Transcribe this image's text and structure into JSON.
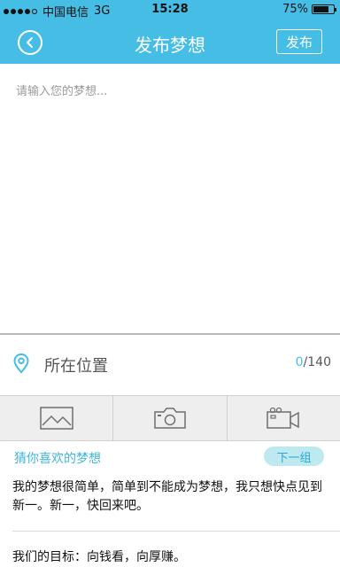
{
  "status_bar": {
    "carrier": "中国电信",
    "network": "3G",
    "time": "15:28",
    "battery_text": "75%",
    "battery_level": 0.75
  },
  "nav": {
    "title": "发布梦想",
    "publish_label": "发布"
  },
  "compose": {
    "placeholder": "请输入您的梦想...",
    "value": ""
  },
  "location": {
    "label": "所在位置",
    "count_current": "0",
    "count_max": "/140"
  },
  "media": {
    "icons": [
      "image-icon",
      "camera-icon",
      "video-icon"
    ]
  },
  "suggestions": {
    "title": "猜你喜欢的梦想",
    "next_label": "下一组",
    "items": [
      "我的梦想很简单，简单到不能成为梦想，我只想快点见到新一。新一，快回来吧。",
      "我们的目标：向钱看，向厚赚。"
    ]
  },
  "colors": {
    "accent": "#46bde4",
    "next_button_bg": "#bfe9f1"
  }
}
